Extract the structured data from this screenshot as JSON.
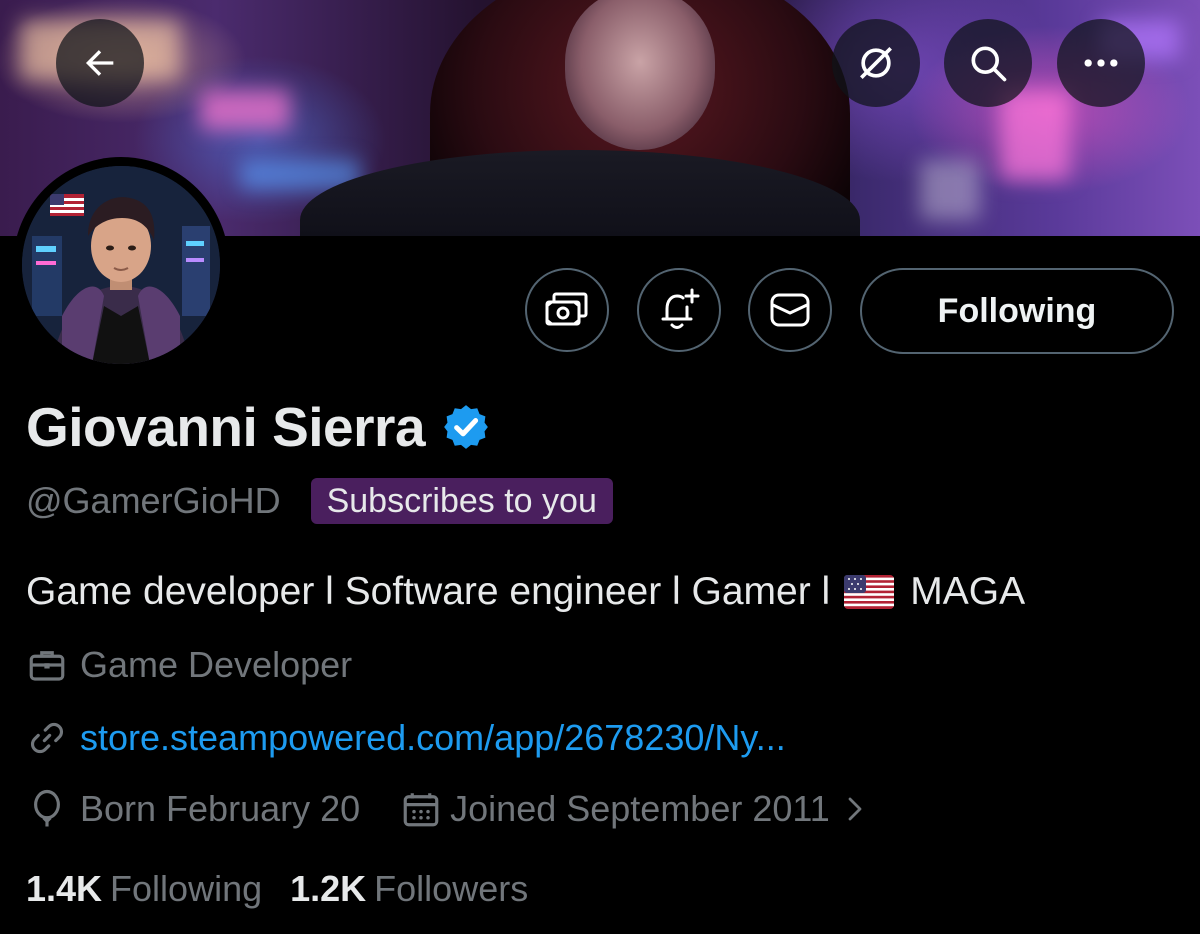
{
  "header": {
    "back_icon": "arrow-left-icon",
    "grok_icon": "grok-icon",
    "search_icon": "search-icon",
    "more_icon": "more-horizontal-icon"
  },
  "profile": {
    "name": "Giovanni Sierra",
    "verified": true,
    "verified_color": "#1d9bf0",
    "handle": "@GamerGioHD",
    "subscribes_badge": "Subscribes to you",
    "subscribes_badge_color": "#4a1f5e",
    "bio_text": "Game developer l Software engineer l Gamer l",
    "bio_flag": "us-flag-emoji",
    "bio_suffix": "MAGA",
    "category": "Game Developer",
    "website": "store.steampowered.com/app/2678230/Ny...",
    "birthday": "Born February 20",
    "joined": "Joined September 2011",
    "following_count": "1.4K",
    "following_label": "Following",
    "followers_count": "1.2K",
    "followers_label": "Followers"
  },
  "actions": {
    "tip_icon": "money-icon",
    "notify_icon": "bell-plus-icon",
    "message_icon": "envelope-icon",
    "follow_label": "Following"
  },
  "colors": {
    "background": "#000000",
    "text_primary": "#e7e9ea",
    "text_secondary": "#71767b",
    "link": "#1d9bf0",
    "button_border": "#536471"
  }
}
